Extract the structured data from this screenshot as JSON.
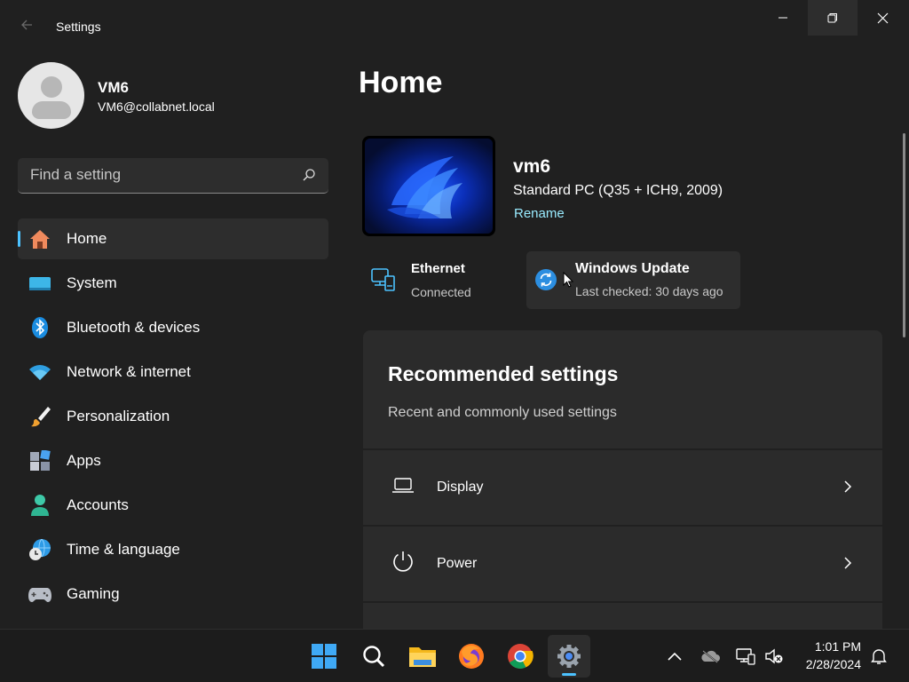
{
  "window": {
    "title": "Settings"
  },
  "profile": {
    "name": "VM6",
    "email": "VM6@collabnet.local"
  },
  "search": {
    "placeholder": "Find a setting"
  },
  "nav": {
    "items": [
      {
        "label": "Home",
        "icon": "home-icon",
        "active": true
      },
      {
        "label": "System",
        "icon": "system-icon"
      },
      {
        "label": "Bluetooth & devices",
        "icon": "bluetooth-icon"
      },
      {
        "label": "Network & internet",
        "icon": "wifi-icon"
      },
      {
        "label": "Personalization",
        "icon": "brush-icon"
      },
      {
        "label": "Apps",
        "icon": "apps-icon"
      },
      {
        "label": "Accounts",
        "icon": "accounts-icon"
      },
      {
        "label": "Time & language",
        "icon": "globe-clock-icon"
      },
      {
        "label": "Gaming",
        "icon": "gamepad-icon"
      }
    ]
  },
  "main": {
    "title": "Home",
    "device": {
      "name": "vm6",
      "model": "Standard PC (Q35 + ICH9, 2009)",
      "rename_label": "Rename"
    },
    "ethernet": {
      "title": "Ethernet",
      "status": "Connected"
    },
    "windows_update": {
      "title": "Windows Update",
      "status": "Last checked: 30 days ago"
    },
    "recommended": {
      "title": "Recommended settings",
      "subtitle": "Recent and commonly used settings",
      "rows": [
        {
          "label": "Display",
          "icon": "laptop-icon"
        },
        {
          "label": "Power",
          "icon": "power-icon"
        }
      ]
    }
  },
  "taskbar": {
    "apps": [
      "start-icon",
      "search-icon",
      "file-explorer-icon",
      "firefox-icon",
      "chrome-icon",
      "settings-icon"
    ],
    "clock": {
      "time": "1:01 PM",
      "date": "2/28/2024"
    }
  },
  "colors": {
    "accent": "#4cc2ff",
    "link": "#99ebff",
    "background": "#202020",
    "card": "#2b2b2b"
  }
}
